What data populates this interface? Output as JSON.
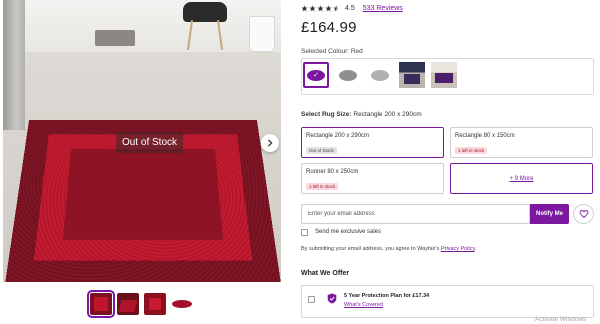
{
  "gallery": {
    "overlay_text": "Out of Stock",
    "next_icon": "chevron-right-icon",
    "thumbnails": [
      "rug-front-view",
      "rug-angle-view",
      "rug-closeup-view",
      "rug-round-view"
    ],
    "selected_thumbnail_index": 0
  },
  "product": {
    "rating": {
      "stars_filled": 4.5,
      "value": "4.5",
      "reviews_label": "533 Reviews"
    },
    "price": "£164.99"
  },
  "colour": {
    "label": "Selected Colour: Red",
    "swatches": [
      "red",
      "grey",
      "light-grey",
      "navy-room",
      "purple-room"
    ],
    "selected_index": 0
  },
  "size": {
    "label_prefix": "Select Rug Size:",
    "label_value": "Rectangle 200 x 290cm",
    "options": [
      {
        "name": "Rectangle 200 x 290cm",
        "badge": "Out of Stock",
        "badge_kind": "out"
      },
      {
        "name": "Rectangle 80 x 150cm",
        "badge": "1 left in stock",
        "badge_kind": "low"
      },
      {
        "name": "Runner 80 x 250cm",
        "badge": "1 left in stock",
        "badge_kind": "low"
      }
    ],
    "more_label": "+ 9 More"
  },
  "notify": {
    "email_placeholder": "Enter your email address",
    "button_label": "Notify Me",
    "exclusive_label": "Send me exclusive sales",
    "consent_text": "By submitting your email address, you agree to Wayfair's ",
    "privacy_link": "Privacy Policy",
    "consent_suffix": "."
  },
  "offer": {
    "heading": "What We Offer",
    "plan_title": "5 Year Protection Plan for £17.34",
    "plan_link": "What's Covered"
  },
  "os": {
    "watermark": "Activate Windows"
  },
  "colors": {
    "accent": "#7b189f",
    "rug_border": "#7a1020",
    "rug_field": "#c0152b"
  }
}
